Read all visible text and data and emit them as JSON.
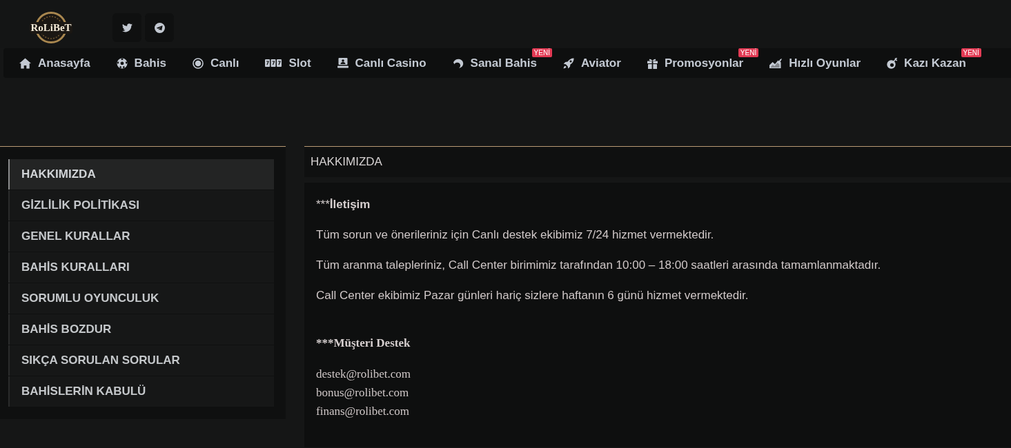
{
  "header": {
    "logo": "RoLiBeT"
  },
  "nav": [
    {
      "label": "Anasayfa"
    },
    {
      "label": "Bahis"
    },
    {
      "label": "Canlı"
    },
    {
      "label": "Slot"
    },
    {
      "label": "Canlı Casino"
    },
    {
      "label": "Sanal Bahis",
      "badge": "YENİ"
    },
    {
      "label": "Aviator"
    },
    {
      "label": "Promosyonlar",
      "badge": "YENİ"
    },
    {
      "label": "Hızlı Oyunlar"
    },
    {
      "label": "Kazı Kazan",
      "badge": "YENİ"
    }
  ],
  "sidebar": {
    "items": [
      {
        "label": "HAKKIMIZDA",
        "selected": true
      },
      {
        "label": "GİZLİLİK POLİTİKASI",
        "selected": false
      },
      {
        "label": "GENEL KURALLAR",
        "selected": false
      },
      {
        "label": "BAHİS KURALLARI",
        "selected": false
      },
      {
        "label": "SORUMLU OYUNCULUK",
        "selected": false
      },
      {
        "label": "BAHİS BOZDUR",
        "selected": false
      },
      {
        "label": "SIKÇA SORULAN SORULAR",
        "selected": false
      },
      {
        "label": "BAHİSLERİN KABULÜ",
        "selected": false
      }
    ]
  },
  "content": {
    "title": "HAKKIMIZDA",
    "blocks": [
      {
        "kind": "heading",
        "prefix": "***",
        "emphasis": "İletişim"
      },
      {
        "kind": "paragraph",
        "text": "Tüm sorun ve önerileriniz için Canlı destek ekibimiz 7/24 hizmet vermektedir."
      },
      {
        "kind": "paragraph",
        "text": "Tüm aranma talepleriniz, Call Center birimimiz tarafından 10:00 – 18:00 saatleri arasında tamamlanmaktadır."
      },
      {
        "kind": "paragraph",
        "text": "Call Center ekibimiz Pazar günleri hariç sizlere haftanın 6 günü hizmet vermektedir."
      },
      {
        "kind": "serif_heading",
        "text": "***Müşteri Destek"
      },
      {
        "kind": "serif_lines",
        "lines": [
          "destek@rolibet.com",
          "bonus@rolibet.com",
          "finans@rolibet.com"
        ]
      }
    ]
  }
}
